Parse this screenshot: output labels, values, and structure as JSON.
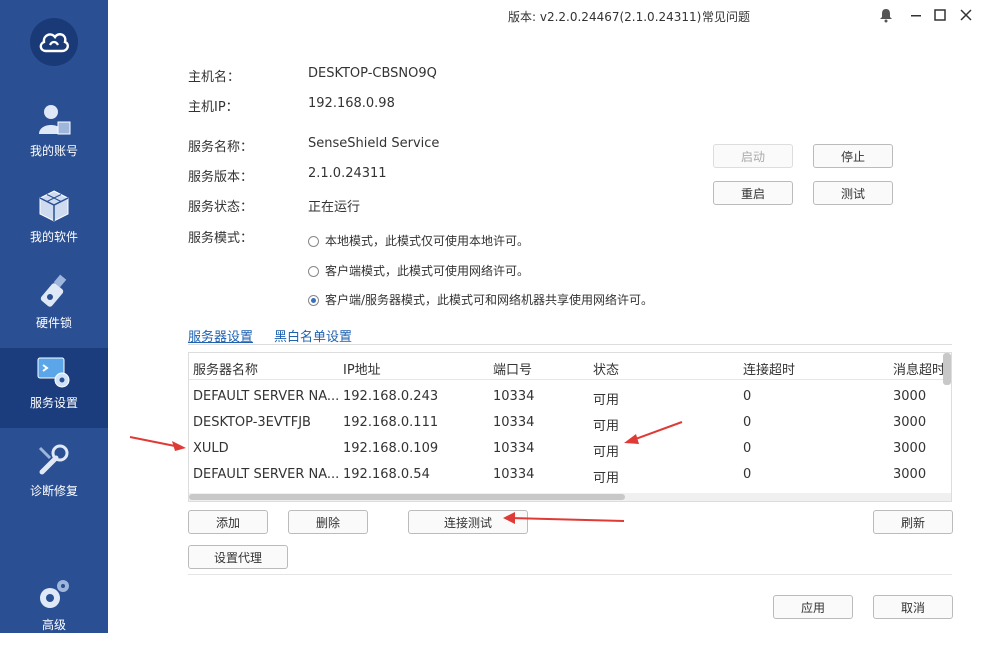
{
  "titlebar": {
    "version": "版本: v2.2.0.24467(2.1.0.24311)",
    "faq": "常见问题"
  },
  "sidebar": {
    "items": [
      {
        "label": "我的账号"
      },
      {
        "label": "我的软件"
      },
      {
        "label": "硬件锁"
      },
      {
        "label": "服务设置"
      },
      {
        "label": "诊断修复"
      },
      {
        "label": "高级"
      }
    ]
  },
  "info": {
    "hostname_label": "主机名：",
    "hostname": "DESKTOP-CBSNO9Q",
    "hostip_label": "主机IP：",
    "hostip": "192.168.0.98",
    "service_name_label": "服务名称：",
    "service_name": "SenseShield Service",
    "service_version_label": "服务版本：",
    "service_version": "2.1.0.24311",
    "service_status_label": "服务状态：",
    "service_status": "正在运行",
    "service_mode_label": "服务模式："
  },
  "modes": [
    {
      "label": "本地模式，此模式仅可使用本地许可。",
      "selected": false
    },
    {
      "label": "客户端模式，此模式可使用网络许可。",
      "selected": false
    },
    {
      "label": "客户端/服务器模式，此模式可和网络机器共享使用网络许可。",
      "selected": true
    }
  ],
  "service_buttons": {
    "start": "启动",
    "stop": "停止",
    "restart": "重启",
    "test": "测试"
  },
  "tabs": {
    "server_settings": "服务器设置",
    "blackwhite": "黑白名单设置"
  },
  "table": {
    "headers": [
      "服务器名称",
      "IP地址",
      "端口号",
      "状态",
      "连接超时",
      "消息超时"
    ],
    "rows": [
      [
        "DEFAULT SERVER NA...",
        "192.168.0.243",
        "10334",
        "可用",
        "0",
        "3000"
      ],
      [
        "DESKTOP-3EVTFJB",
        "192.168.0.111",
        "10334",
        "可用",
        "0",
        "3000"
      ],
      [
        "XULD",
        "192.168.0.109",
        "10334",
        "可用",
        "0",
        "3000"
      ],
      [
        "DEFAULT SERVER NA...",
        "192.168.0.54",
        "10334",
        "可用",
        "0",
        "3000"
      ]
    ]
  },
  "table_buttons": {
    "add": "添加",
    "delete": "删除",
    "connect_test": "连接测试",
    "refresh": "刷新",
    "proxy": "设置代理"
  },
  "footer": {
    "apply": "应用",
    "cancel": "取消"
  },
  "colors": {
    "sidebar": "#2a4f93",
    "sidebar_active": "#1b3d7e",
    "link": "#1f62b0",
    "arrow": "#e03a36"
  }
}
